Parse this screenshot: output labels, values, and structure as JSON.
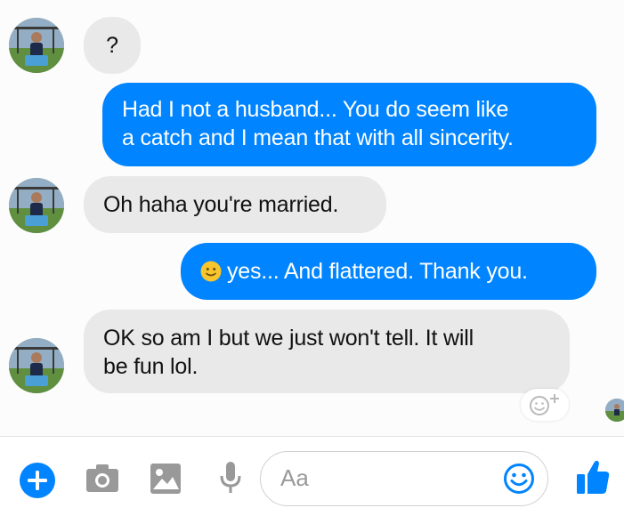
{
  "messages": [
    {
      "from": "contact",
      "text": "?"
    },
    {
      "from": "me",
      "lines": [
        "Had I not a husband... You do seem like",
        "a catch and I mean that with all sincerity."
      ]
    },
    {
      "from": "contact",
      "text": "Oh haha you're married."
    },
    {
      "from": "me",
      "emoji": "slightly-smiling-face",
      "text": "yes... And flattered. Thank you."
    },
    {
      "from": "contact",
      "lines": [
        "OK so am I but we just won't tell. It will",
        "be fun lol."
      ]
    }
  ],
  "composer": {
    "placeholder": "Aa",
    "icons": [
      "plus-icon",
      "camera-icon",
      "image-icon",
      "microphone-icon",
      "emoji-icon",
      "thumbs-up-icon"
    ]
  },
  "colors": {
    "outgoing_bubble": "#0084ff",
    "incoming_bubble": "#e9e9ea",
    "accent": "#0084ff"
  }
}
